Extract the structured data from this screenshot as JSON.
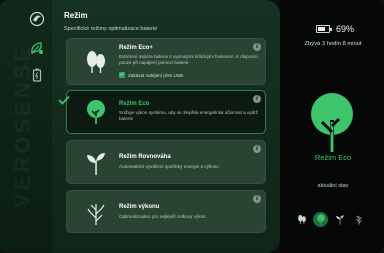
{
  "rail": {
    "watermark": "VEROSENSE",
    "items": [
      {
        "icon": "logo-icon"
      },
      {
        "icon": "leaf-settings-icon",
        "active": true
      },
      {
        "icon": "battery-outline-icon"
      }
    ]
  },
  "header": {
    "title": "Režim",
    "subtitle": "Specifické režimy optimalizace baterie"
  },
  "modes": [
    {
      "icon": "trees-icon",
      "name": "Režim Eco+",
      "description": "Extrémní úspora baterie s vypnutými kritickými funkcemi. K dispozici pouze při napájení pomocí baterie",
      "checkbox_label": "Zakázat nabíjení přes USB",
      "checkbox_checked": true
    },
    {
      "icon": "tree-icon",
      "name": "Režim Eco",
      "description": "Snižuje výkon systému, aby se zlepšila energetická účinnost a výdrž baterie",
      "active": true
    },
    {
      "icon": "sprout-icon",
      "name": "Režim Rovnováha",
      "description": "Automatické vyvážení spotřeby energie a výkonu"
    },
    {
      "icon": "bare-tree-icon",
      "name": "Režim výkonu",
      "description": "Optimalizováno pro nejlepší celkový výkon"
    }
  ],
  "status": {
    "battery_percent": "69%",
    "battery_level": 0.69,
    "remaining": "Zbývá 3 hodin 8 minut",
    "current_mode": "Režim Eco",
    "current_label": "aktuální stav"
  },
  "colors": {
    "accent": "#3ec56c",
    "panel": "#163223",
    "card": "#2a4434",
    "active_card": "#0c1a12"
  }
}
